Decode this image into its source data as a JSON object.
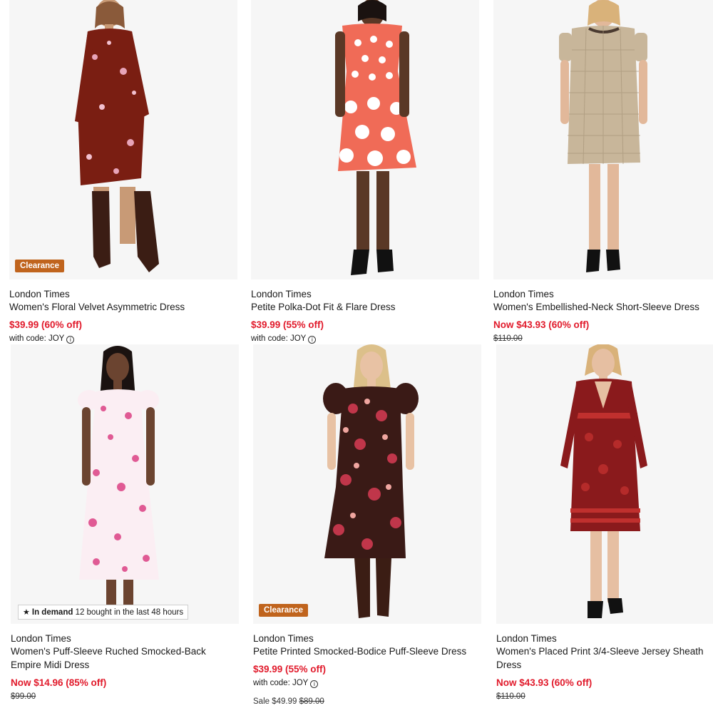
{
  "products": [
    {
      "brand": "London Times",
      "title": "Women's Floral Velvet Asymmetric Dress",
      "price": "$39.99 (60% off)",
      "code_label": "with code: JOY",
      "badge": "Clearance"
    },
    {
      "brand": "London Times",
      "title": "Petite Polka-Dot Fit & Flare Dress",
      "price": "$39.99 (55% off)",
      "code_label": "with code: JOY"
    },
    {
      "brand": "London Times",
      "title": "Women's Embellished-Neck Short-Sleeve Dress",
      "price": "Now $43.93 (60% off)",
      "original_price": "$110.00"
    },
    {
      "brand": "London Times",
      "title": "Women's Puff-Sleeve Ruched Smocked-Back Empire Midi Dress",
      "price": "Now $14.96 (85% off)",
      "original_price": "$99.00",
      "demand_badge": {
        "strong": "In demand",
        "text": "12 bought in the last 48 hours",
        "icon": "star-icon"
      }
    },
    {
      "brand": "London Times",
      "title": "Petite Printed Smocked-Bodice Puff-Sleeve Dress",
      "price": "$39.99 (55% off)",
      "code_label": "with code: JOY",
      "sale_label": "Sale $49.99",
      "sale_original": "$89.00",
      "badge": "Clearance"
    },
    {
      "brand": "London Times",
      "title": "Women's Placed Print 3/4-Sleeve Jersey Sheath Dress",
      "price": "Now $43.93 (60% off)",
      "original_price": "$110.00"
    }
  ],
  "colors": {
    "sale_red": "#e11a2b",
    "clearance_badge": "#c0641d"
  },
  "icons": {
    "info": "info-icon",
    "star": "star-icon"
  }
}
